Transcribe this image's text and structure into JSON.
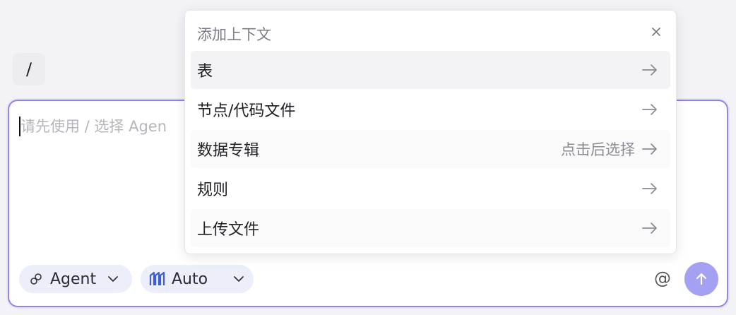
{
  "slash_chip": "/",
  "composer": {
    "placeholder": "请先使用 / 选择 Agen",
    "agent_pill": {
      "label": "Agent",
      "icon": "link-icon"
    },
    "model_pill": {
      "label": "Auto",
      "icon": "model-icon"
    },
    "at_symbol": "@",
    "send_icon": "arrow-up-icon",
    "border_color": "#8f86ec",
    "send_color": "#a4a1f3"
  },
  "context_menu": {
    "title": "添加上下文",
    "close_icon": "close-icon",
    "items": [
      {
        "label": "表",
        "hint": ""
      },
      {
        "label": "节点/代码文件",
        "hint": ""
      },
      {
        "label": "数据专辑",
        "hint": "点击后选择"
      },
      {
        "label": "规则",
        "hint": ""
      },
      {
        "label": "上传文件",
        "hint": ""
      }
    ]
  }
}
